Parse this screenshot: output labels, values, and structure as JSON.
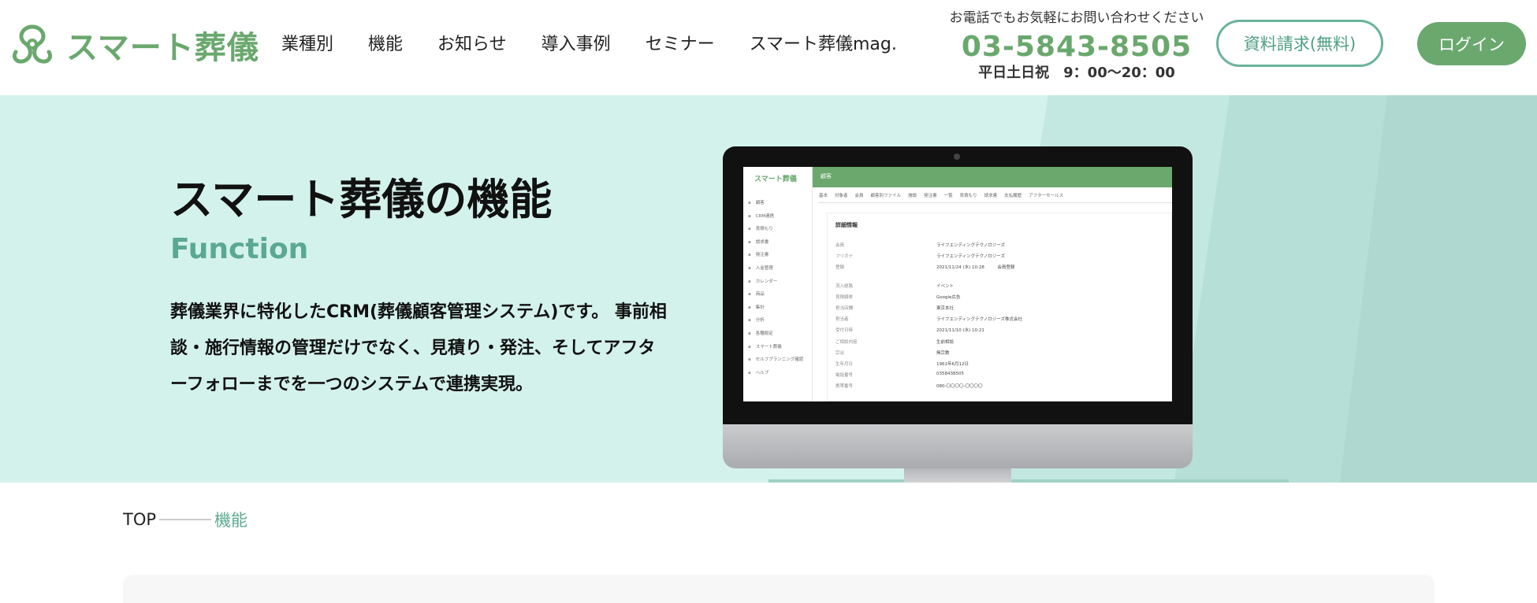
{
  "header": {
    "logo_text": "スマート葬儀",
    "nav": [
      "業種別",
      "機能",
      "お知らせ",
      "導入事例",
      "セミナー",
      "スマート葬儀mag."
    ],
    "contact_note": "お電話でもお気軽にお問い合わせください",
    "phone": "03-5843-8505",
    "hours": "平日土日祝　9：00〜20：00",
    "doc_button": "資料請求(無料)",
    "login_button": "ログイン"
  },
  "hero": {
    "title": "スマート葬儀の機能",
    "subtitle": "Function",
    "description": "葬儀業界に特化したCRM(葬儀顧客管理システム)です。 事前相談・施行情報の管理だけでなく、見積り・発注、そしてアフターフォローまでを一つのシステムで連携実現。"
  },
  "screen": {
    "logo": "スマート葬儀",
    "topbar": "顧客",
    "menu": [
      "顧客",
      "CRM連携",
      "見積もり",
      "請求書",
      "発注書",
      "入金管理",
      "カレンダー",
      "商品",
      "集計",
      "分析",
      "各種設定",
      "スマート葬儀",
      "セルフプランニング確認",
      "ヘルプ"
    ],
    "tabs": [
      "基本",
      "対象者",
      "会員",
      "顧客別ファイル",
      "施設",
      "発注書",
      "一覧",
      "見積もり",
      "請求書",
      "支払履歴",
      "アフターセールス"
    ],
    "panel_title": "詳細情報",
    "rows_a": [
      {
        "k": "会員",
        "v": "ライフエンディングテクノロジーズ"
      },
      {
        "k": "フリガナ",
        "v": "ライフエンディングテクノロジーズ"
      },
      {
        "k": "登録",
        "v": "2021/11/24 (水) 10:28　　　会員登録"
      }
    ],
    "rows_b": [
      {
        "k": "流入経路",
        "v": "イベント"
      },
      {
        "k": "見積媒体",
        "v": "Google広告"
      },
      {
        "k": "担当店舗",
        "v": "東京本社"
      },
      {
        "k": "担当者",
        "v": "ライフエンディングテクノロジーズ株式会社"
      },
      {
        "k": "受付日時",
        "v": "2021/11/10 (水) 10:21"
      },
      {
        "k": "ご相談内容",
        "v": "生前相談"
      },
      {
        "k": "宗派",
        "v": "無宗教"
      },
      {
        "k": "生年月日",
        "v": "1961年6月12日"
      },
      {
        "k": "電話番号",
        "v": "0358438505"
      },
      {
        "k": "携帯番号",
        "v": "080-〇〇〇〇-〇〇〇〇"
      }
    ]
  },
  "breadcrumb": {
    "top": "TOP",
    "current": "機能"
  },
  "colors": {
    "brand_green": "#6aa86e",
    "accent_teal": "#5aa990",
    "hero_bg": "#d4f2ec"
  }
}
